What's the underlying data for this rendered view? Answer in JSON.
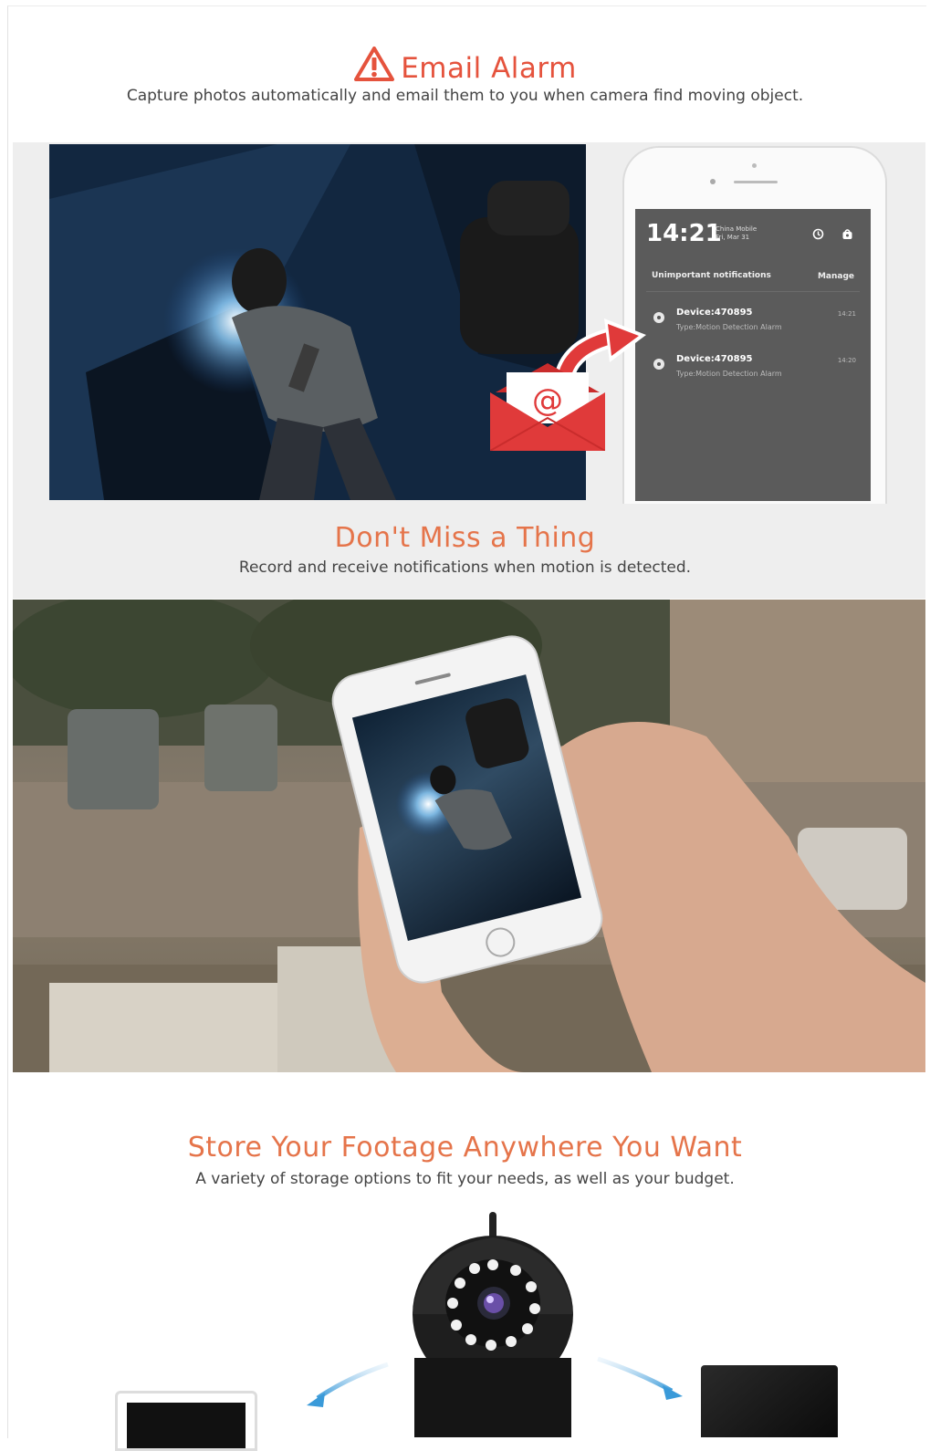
{
  "email_alarm": {
    "title": "Email Alarm",
    "subtitle": "Capture photos automatically and email them to you when camera find moving object."
  },
  "phone_screen": {
    "clock": "14:21",
    "carrier": "China Mobile",
    "date": "Fri, Mar 31",
    "section_label": "Unimportant notifications",
    "manage_label": "Manage",
    "notifications": [
      {
        "device": "Device:470895",
        "type": "Type:Motion Detection Alarm",
        "time": "14:21"
      },
      {
        "device": "Device:470895",
        "type": "Type:Motion Detection Alarm",
        "time": "14:20"
      }
    ]
  },
  "dont_miss": {
    "title": "Don't Miss a Thing",
    "subtitle": "Record and receive notifications when motion is detected."
  },
  "store": {
    "title": "Store Your Footage Anywhere You Want",
    "subtitle": "A variety of storage options to fit your needs, as well as your budget."
  },
  "colors": {
    "accent": "#e5533d",
    "accent_alt": "#e5744a",
    "envelope": "#e03a3a"
  }
}
